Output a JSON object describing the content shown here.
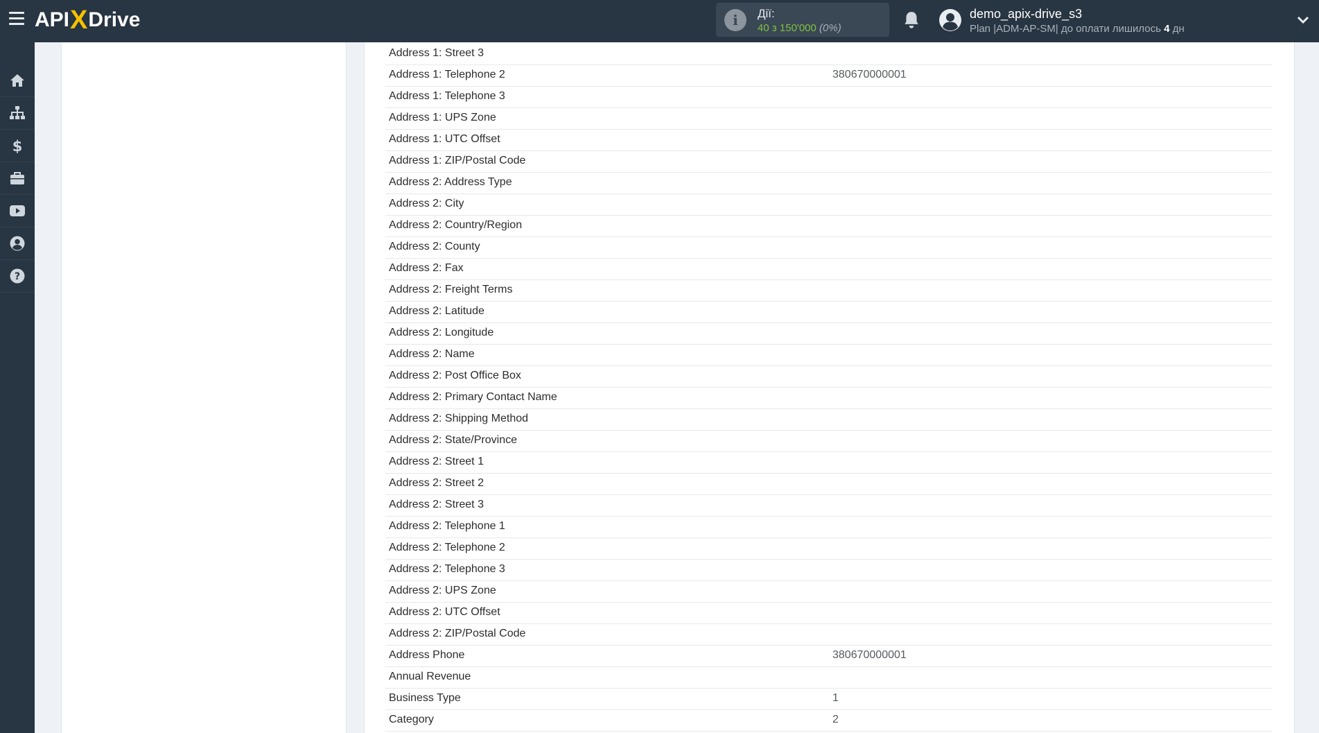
{
  "header": {
    "logo": {
      "left": "API",
      "x": "X",
      "right": "Drive"
    },
    "actions": {
      "label": "Дії:",
      "used": "40",
      "of": "з",
      "total": "150'000",
      "percent": "(0%)"
    },
    "user": {
      "name": "demo_apix-drive_s3",
      "plan_prefix": "Plan |ADM-AP-SM| до оплати лишилось ",
      "days": "4",
      "days_unit": " дн"
    }
  },
  "sidebar": {
    "items": [
      {
        "icon": "home-icon"
      },
      {
        "icon": "sitemap-icon"
      },
      {
        "icon": "dollar-icon"
      },
      {
        "icon": "briefcase-icon"
      },
      {
        "icon": "youtube-icon"
      },
      {
        "icon": "user-circle-icon"
      },
      {
        "icon": "help-icon"
      }
    ]
  },
  "fields": [
    {
      "label": "Address 1: Street 3",
      "value": ""
    },
    {
      "label": "Address 1: Telephone 2",
      "value": "380670000001"
    },
    {
      "label": "Address 1: Telephone 3",
      "value": ""
    },
    {
      "label": "Address 1: UPS Zone",
      "value": ""
    },
    {
      "label": "Address 1: UTC Offset",
      "value": ""
    },
    {
      "label": "Address 1: ZIP/Postal Code",
      "value": ""
    },
    {
      "label": "Address 2: Address Type",
      "value": ""
    },
    {
      "label": "Address 2: City",
      "value": ""
    },
    {
      "label": "Address 2: Country/Region",
      "value": ""
    },
    {
      "label": "Address 2: County",
      "value": ""
    },
    {
      "label": "Address 2: Fax",
      "value": ""
    },
    {
      "label": "Address 2: Freight Terms",
      "value": ""
    },
    {
      "label": "Address 2: Latitude",
      "value": ""
    },
    {
      "label": "Address 2: Longitude",
      "value": ""
    },
    {
      "label": "Address 2: Name",
      "value": ""
    },
    {
      "label": "Address 2: Post Office Box",
      "value": ""
    },
    {
      "label": "Address 2: Primary Contact Name",
      "value": ""
    },
    {
      "label": "Address 2: Shipping Method",
      "value": ""
    },
    {
      "label": "Address 2: State/Province",
      "value": ""
    },
    {
      "label": "Address 2: Street 1",
      "value": ""
    },
    {
      "label": "Address 2: Street 2",
      "value": ""
    },
    {
      "label": "Address 2: Street 3",
      "value": ""
    },
    {
      "label": "Address 2: Telephone 1",
      "value": ""
    },
    {
      "label": "Address 2: Telephone 2",
      "value": ""
    },
    {
      "label": "Address 2: Telephone 3",
      "value": ""
    },
    {
      "label": "Address 2: UPS Zone",
      "value": ""
    },
    {
      "label": "Address 2: UTC Offset",
      "value": ""
    },
    {
      "label": "Address 2: ZIP/Postal Code",
      "value": ""
    },
    {
      "label": "Address Phone",
      "value": "380670000001"
    },
    {
      "label": "Annual Revenue",
      "value": ""
    },
    {
      "label": "Business Type",
      "value": "1"
    },
    {
      "label": "Category",
      "value": "2"
    }
  ]
}
